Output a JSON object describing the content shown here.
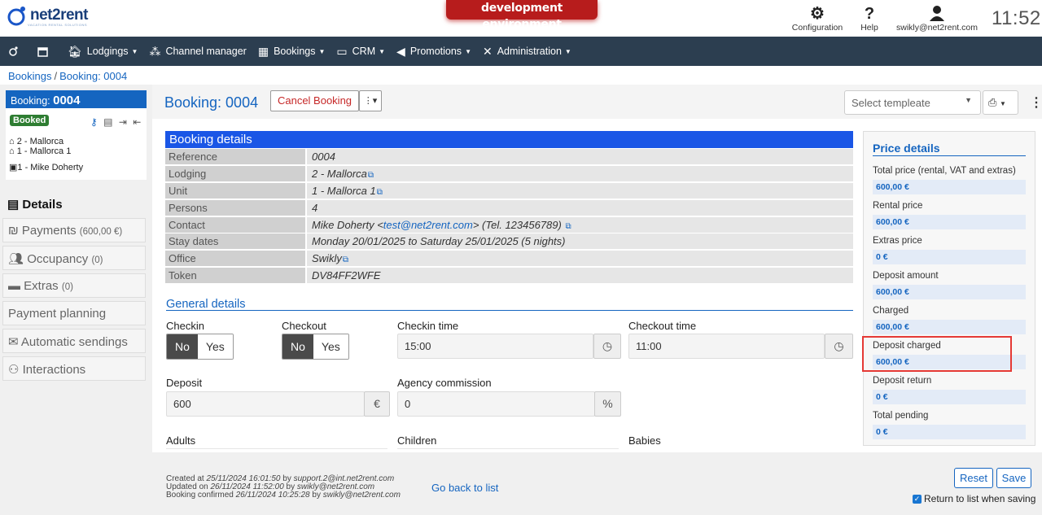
{
  "topbar": {
    "logo_text": "net2rent",
    "logo_sub": "VACATION RENTAL SOLUTIONS",
    "env_banner": "development environment",
    "configuration_label": "Configuration",
    "help_label": "Help",
    "user_label": "swikly@net2rent.com",
    "clock": "11:52"
  },
  "nav": {
    "items": [
      {
        "label": "Lodgings",
        "icon": "home-icon"
      },
      {
        "label": "Channel manager",
        "icon": "network-icon"
      },
      {
        "label": "Bookings",
        "icon": "calendar-check-icon"
      },
      {
        "label": "CRM",
        "icon": "id-card-icon"
      },
      {
        "label": "Promotions",
        "icon": "megaphone-icon"
      },
      {
        "label": "Administration",
        "icon": "tools-icon"
      }
    ]
  },
  "breadcrumb": {
    "root": "Bookings",
    "current": "Booking: 0004"
  },
  "card": {
    "title_prefix": "Booking: ",
    "title_number": "0004",
    "status": "Booked",
    "lodging": "2 - Mallorca",
    "unit": "1 - Mallorca 1",
    "client": "1 - Mike Doherty"
  },
  "sidetabs": {
    "details": "Details",
    "payments": "Payments",
    "payments_amount": "(600,00 €)",
    "occupancy": "Occupancy",
    "occupancy_count": "(0)",
    "extras": "Extras",
    "extras_count": "(0)",
    "payment_planning": "Payment planning",
    "automatic_sendings": "Automatic sendings",
    "interactions": "Interactions"
  },
  "header": {
    "title": "Booking: 0004",
    "cancel_label": "Cancel Booking",
    "template_placeholder": "Select templeate"
  },
  "booking_details": {
    "heading": "Booking details",
    "rows": [
      {
        "key": "Reference",
        "value": "0004"
      },
      {
        "key": "Lodging",
        "value": "2 - Mallorca"
      },
      {
        "key": "Unit",
        "value": "1 - Mallorca 1"
      },
      {
        "key": "Persons",
        "value": "4"
      },
      {
        "key": "Contact",
        "value_pre": "Mike Doherty <",
        "email": "test@net2rent.com",
        "value_post": "> (Tel. 123456789)"
      },
      {
        "key": "Stay dates",
        "value": "Monday 20/01/2025 to Saturday 25/01/2025 (5 nights)"
      },
      {
        "key": "Office",
        "value": "Swikly"
      },
      {
        "key": "Token",
        "value": "DV84FF2WFE"
      }
    ]
  },
  "general": {
    "heading": "General details",
    "checkin_label": "Checkin",
    "checkout_label": "Checkout",
    "no": "No",
    "yes": "Yes",
    "checkin_time_label": "Checkin time",
    "checkin_time": "15:00",
    "checkout_time_label": "Checkout time",
    "checkout_time": "11:00",
    "deposit_label": "Deposit",
    "deposit_value": "600",
    "deposit_unit": "€",
    "agency_label": "Agency commission",
    "agency_value": "0",
    "agency_unit": "%",
    "adults_label": "Adults",
    "children_label": "Children",
    "babies_label": "Babies"
  },
  "price": {
    "title": "Price details",
    "items": [
      {
        "label": "Total price (rental, VAT and extras)",
        "value": "600,00 €"
      },
      {
        "label": "Rental price",
        "value": "600,00 €"
      },
      {
        "label": "Extras price",
        "value": "0 €"
      },
      {
        "label": "Deposit amount",
        "value": "600,00 €"
      },
      {
        "label": "Charged",
        "value": "600,00 €"
      },
      {
        "label": "Deposit charged",
        "value": "600,00 €"
      },
      {
        "label": "Deposit return",
        "value": "0 €"
      },
      {
        "label": "Total pending",
        "value": "0 €"
      }
    ]
  },
  "footer": {
    "created_pre": "Created at ",
    "created_date": "25/11/2024 16:01:50",
    "created_by_pre": " by ",
    "created_by": "support.2@int.net2rent.com",
    "updated_pre": "Updated on ",
    "updated_date": "26/11/2024 11:52:00",
    "updated_by": "swikly@net2rent.com",
    "confirmed_pre": "Booking confirmed ",
    "confirmed_date": "26/11/2024 10:25:28",
    "confirmed_by": "swikly@net2rent.com",
    "back_link": "Go back to list",
    "reset": "Reset",
    "save": "Save",
    "return_label": "Return to list when saving"
  }
}
